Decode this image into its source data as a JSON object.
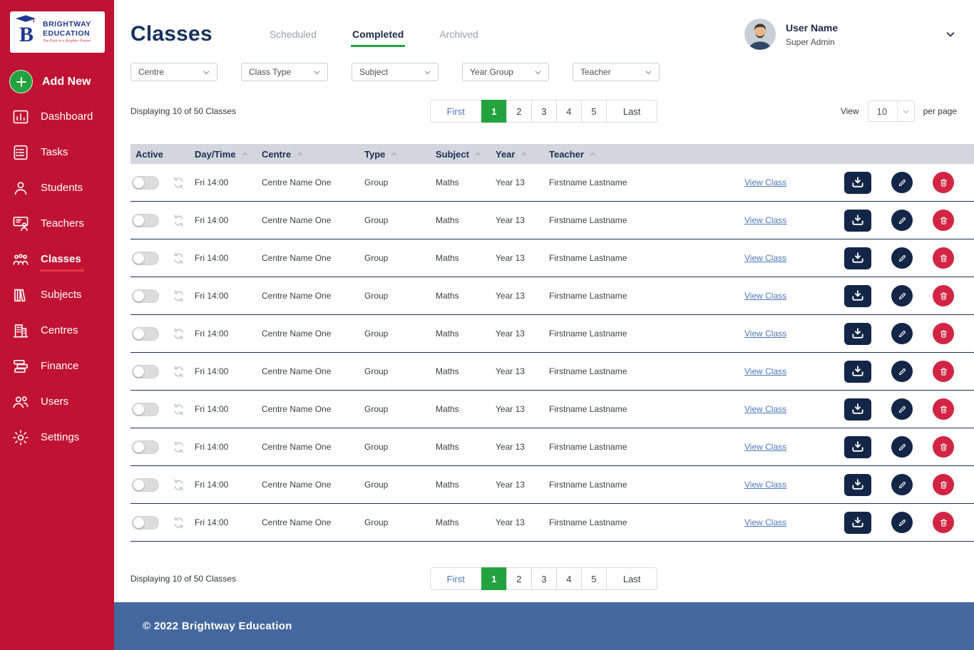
{
  "colors": {
    "sidebar_bg": "#c01232",
    "sidebar_active_underline": "#e8323c",
    "accent_green": "#23a33f",
    "navy": "#16325c",
    "icon_navy": "#132647",
    "danger_red": "#d22543",
    "link_blue": "#4a78b8",
    "table_header_bg": "#d3d6dd",
    "row_divider": "#1e3250",
    "footer_bg": "#44679e"
  },
  "sidebar": {
    "logo": {
      "monogram": "B",
      "brand_line1": "BRIGHTWAY",
      "brand_line2": "EDUCATION",
      "tagline": "The Path to a Brighter Future"
    },
    "add_new": {
      "label": "Add New",
      "icon": "plus-icon"
    },
    "items": [
      {
        "label": "Dashboard",
        "icon": "dashboard-icon",
        "active": false
      },
      {
        "label": "Tasks",
        "icon": "tasks-icon",
        "active": false
      },
      {
        "label": "Students",
        "icon": "students-icon",
        "active": false
      },
      {
        "label": "Teachers",
        "icon": "teachers-icon",
        "active": false
      },
      {
        "label": "Classes",
        "icon": "classes-icon",
        "active": true
      },
      {
        "label": "Subjects",
        "icon": "subjects-icon",
        "active": false
      },
      {
        "label": "Centres",
        "icon": "centres-icon",
        "active": false
      },
      {
        "label": "Finance",
        "icon": "finance-icon",
        "active": false
      },
      {
        "label": "Users",
        "icon": "users-icon",
        "active": false
      },
      {
        "label": "Settings",
        "icon": "settings-icon",
        "active": false
      }
    ]
  },
  "header": {
    "title": "Classes",
    "tabs": [
      {
        "label": "Scheduled",
        "active": false
      },
      {
        "label": "Completed",
        "active": true
      },
      {
        "label": "Archived",
        "active": false
      }
    ],
    "user": {
      "name": "User Name",
      "role": "Super Admin"
    }
  },
  "filters": [
    {
      "label": "Centre"
    },
    {
      "label": "Class Type"
    },
    {
      "label": "Subject"
    },
    {
      "label": "Year Group"
    },
    {
      "label": "Teacher"
    }
  ],
  "list_controls": {
    "summary": "Displaying 10 of 50 Classes",
    "pagination": {
      "first": "First",
      "pages": [
        "1",
        "2",
        "3",
        "4",
        "5"
      ],
      "active_page": "1",
      "last": "Last"
    },
    "view": {
      "label": "View",
      "value": "10",
      "suffix": "per page"
    }
  },
  "table": {
    "headers": [
      {
        "label": "Active",
        "sortable": false
      },
      {
        "label": "Day/Time",
        "sortable": true
      },
      {
        "label": "Centre",
        "sortable": true
      },
      {
        "label": "Type",
        "sortable": true
      },
      {
        "label": "Subject",
        "sortable": true
      },
      {
        "label": "Year",
        "sortable": true
      },
      {
        "label": "Teacher",
        "sortable": true
      }
    ],
    "row_actions": [
      {
        "name": "download",
        "icon": "download-icon"
      },
      {
        "name": "edit",
        "icon": "pencil-icon"
      },
      {
        "name": "delete",
        "icon": "trash-icon"
      }
    ],
    "rows": [
      {
        "active": false,
        "day_time": "Fri 14:00",
        "centre": "Centre Name One",
        "type": "Group",
        "subject": "Maths",
        "year": "Year 13",
        "teacher": "Firstname Lastname",
        "link": "View Class"
      },
      {
        "active": false,
        "day_time": "Fri 14:00",
        "centre": "Centre Name One",
        "type": "Group",
        "subject": "Maths",
        "year": "Year 13",
        "teacher": "Firstname Lastname",
        "link": "View Class"
      },
      {
        "active": false,
        "day_time": "Fri 14:00",
        "centre": "Centre Name One",
        "type": "Group",
        "subject": "Maths",
        "year": "Year 13",
        "teacher": "Firstname Lastname",
        "link": "View Class"
      },
      {
        "active": false,
        "day_time": "Fri 14:00",
        "centre": "Centre Name One",
        "type": "Group",
        "subject": "Maths",
        "year": "Year 13",
        "teacher": "Firstname Lastname",
        "link": "View Class"
      },
      {
        "active": false,
        "day_time": "Fri 14:00",
        "centre": "Centre Name One",
        "type": "Group",
        "subject": "Maths",
        "year": "Year 13",
        "teacher": "Firstname Lastname",
        "link": "View Class"
      },
      {
        "active": false,
        "day_time": "Fri 14:00",
        "centre": "Centre Name One",
        "type": "Group",
        "subject": "Maths",
        "year": "Year 13",
        "teacher": "Firstname Lastname",
        "link": "View Class"
      },
      {
        "active": false,
        "day_time": "Fri 14:00",
        "centre": "Centre Name One",
        "type": "Group",
        "subject": "Maths",
        "year": "Year 13",
        "teacher": "Firstname Lastname",
        "link": "View Class"
      },
      {
        "active": false,
        "day_time": "Fri 14:00",
        "centre": "Centre Name One",
        "type": "Group",
        "subject": "Maths",
        "year": "Year 13",
        "teacher": "Firstname Lastname",
        "link": "View Class"
      },
      {
        "active": false,
        "day_time": "Fri 14:00",
        "centre": "Centre Name One",
        "type": "Group",
        "subject": "Maths",
        "year": "Year 13",
        "teacher": "Firstname Lastname",
        "link": "View Class"
      },
      {
        "active": false,
        "day_time": "Fri 14:00",
        "centre": "Centre Name One",
        "type": "Group",
        "subject": "Maths",
        "year": "Year 13",
        "teacher": "Firstname Lastname",
        "link": "View Class"
      }
    ]
  },
  "footer": {
    "copyright": "© 2022 Brightway Education"
  }
}
